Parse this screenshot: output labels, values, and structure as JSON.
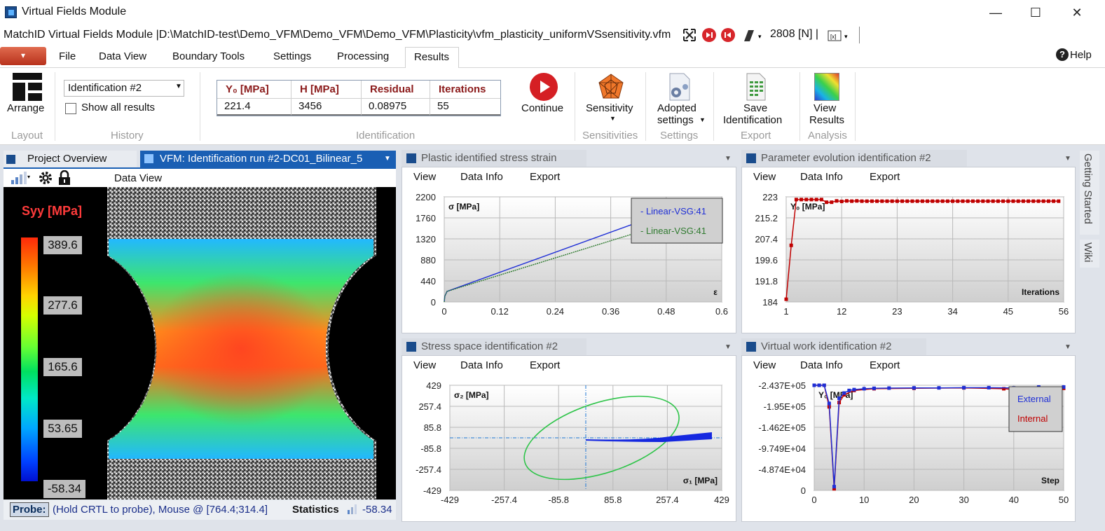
{
  "window": {
    "title": "Virtual Fields Module",
    "min": "—",
    "max": "☐",
    "close": "✕"
  },
  "qat": {
    "path": "MatchID Virtual Fields Module |D:\\MatchID-test\\Demo_VFM\\Demo_VFM\\Demo_VFM\\Plasticity\\vfm_plasticity_uniformVSsensitivity.vfm",
    "force": "2808 [N] |"
  },
  "menu": {
    "items": [
      "File",
      "Data View",
      "Boundary Tools",
      "Settings",
      "Processing",
      "Results"
    ],
    "help": "Help"
  },
  "ribbon": {
    "arrange": "Arrange",
    "layout_group": "Layout",
    "history_select": "Identification #2",
    "show_all": "Show all results",
    "history_group": "History",
    "id_headers": [
      "Y₀ [MPa]",
      "H [MPa]",
      "Residual",
      "Iterations"
    ],
    "id_values": [
      "221.4",
      "3456",
      "0.08975",
      "55"
    ],
    "identification_group": "Identification",
    "continue": "Continue",
    "sensitivity": "Sensitivity",
    "sensitivities_group": "Sensitivities",
    "adopted1": "Adopted",
    "adopted2": "settings",
    "settings_group": "Settings",
    "save1": "Save",
    "save2": "Identification",
    "export_group": "Export",
    "view1": "View",
    "view2": "Results",
    "analysis_group": "Analysis"
  },
  "left": {
    "tab_overview": "Project Overview",
    "tab_vfm": "VFM: Identification run #2-DC01_Bilinear_5",
    "dataview": "Data View",
    "colorbar_title": "Syy [MPa]",
    "colorbar_labels": [
      "389.6",
      "277.6",
      "165.6",
      "53.65",
      "-58.34"
    ],
    "probe_label": "Probe:",
    "probe_text": "(Hold CRTL to probe), Mouse @ [764.4;314.4]",
    "statistics": "Statistics",
    "stat_value": "-58.34"
  },
  "panels": {
    "stress_strain": "Plastic identified stress strain",
    "param_evo": "Parameter evolution identification #2",
    "stress_space": "Stress space identification #2",
    "virtual_work": "Virtual work identification #2",
    "tabs": [
      "View",
      "Data Info",
      "Export"
    ]
  },
  "side": {
    "getting_started": "Getting Started",
    "wiki": "Wiki"
  },
  "colors": {
    "accent": "#1a5fb4",
    "results_tab": "#ffffff",
    "title_red": "#8b1a1a"
  },
  "chart_data": [
    {
      "type": "line",
      "title": "",
      "ylabel": "σ [MPa]",
      "xlabel": "ε",
      "xlim": [
        0,
        0.6
      ],
      "ylim": [
        0,
        2200
      ],
      "xticks": [
        "0",
        "0.12",
        "0.24",
        "0.36",
        "0.48",
        "0.6"
      ],
      "yticks": [
        "0",
        "440",
        "880",
        "1320",
        "1760",
        "2200"
      ],
      "series": [
        {
          "name": "Linear-VSG:41",
          "color": "#1f2fd6",
          "x": [
            0,
            0.0012,
            0.006,
            0.5
          ],
          "y": [
            0,
            120,
            221,
            1950
          ]
        },
        {
          "name": "Linear-VSG:41",
          "color": "#2f7a2f",
          "x": [
            0,
            0.0012,
            0.006,
            0.5
          ],
          "y": [
            0,
            120,
            221,
            1700
          ]
        }
      ],
      "legend": "top-right"
    },
    {
      "type": "line",
      "ylabel": "Y₀ [MPa]",
      "xlabel": "Iterations",
      "xlim": [
        1,
        56
      ],
      "ylim": [
        184,
        223
      ],
      "xticks": [
        "1",
        "12",
        "23",
        "34",
        "45",
        "56"
      ],
      "yticks": [
        "184",
        "191.8",
        "199.6",
        "207.4",
        "215.2",
        "223"
      ],
      "series": [
        {
          "name": "Y₀",
          "color": "#c00000",
          "x": [
            1,
            2,
            3,
            4,
            5,
            6,
            7,
            8,
            9,
            10,
            11,
            12,
            13,
            14,
            15,
            16,
            17,
            18,
            19,
            20,
            21,
            22,
            23,
            24,
            25,
            26,
            27,
            28,
            29,
            30,
            31,
            32,
            33,
            34,
            35,
            36,
            37,
            38,
            39,
            40,
            41,
            42,
            43,
            44,
            45,
            46,
            47,
            48,
            49,
            50,
            51,
            52,
            53,
            54,
            55
          ],
          "y": [
            185,
            205,
            222,
            222,
            222,
            222,
            222,
            222,
            221,
            221,
            221.5,
            221.3,
            221.5,
            221.4,
            221.5,
            221.4,
            221.4,
            221.4,
            221.4,
            221.4,
            221.4,
            221.4,
            221.4,
            221.4,
            221.4,
            221.4,
            221.4,
            221.4,
            221.4,
            221.4,
            221.4,
            221.4,
            221.4,
            221.4,
            221.4,
            221.4,
            221.4,
            221.4,
            221.4,
            221.4,
            221.4,
            221.4,
            221.4,
            221.4,
            221.4,
            221.4,
            221.4,
            221.4,
            221.4,
            221.4,
            221.4,
            221.4,
            221.4,
            221.4,
            221.4
          ]
        }
      ]
    },
    {
      "type": "scatter",
      "ylabel": "σ₂ [MPa]",
      "xlabel": "σ₁ [MPa]",
      "xlim": [
        -429,
        429
      ],
      "ylim": [
        -429,
        429
      ],
      "xticks": [
        "-429",
        "-257.4",
        "-85.8",
        "85.8",
        "257.4",
        "429"
      ],
      "yticks": [
        "-429",
        "-257.4",
        "-85.8",
        "85.8",
        "257.4",
        "429"
      ]
    },
    {
      "type": "line",
      "ylabel": "Y₀ [MPa]",
      "xlabel": "Step",
      "xlim": [
        0,
        50
      ],
      "ylim": [
        -243700,
        0
      ],
      "xticks": [
        "0",
        "10",
        "20",
        "30",
        "40",
        "50"
      ],
      "yticks": [
        "0",
        "-4.874E+04",
        "-9.749E+04",
        "-1.462E+05",
        "-1.95E+05",
        "-2.437E+05"
      ],
      "series": [
        {
          "name": "External",
          "color": "#1f2fd6"
        },
        {
          "name": "Internal",
          "color": "#c00000"
        }
      ],
      "legend": "top-right"
    }
  ]
}
